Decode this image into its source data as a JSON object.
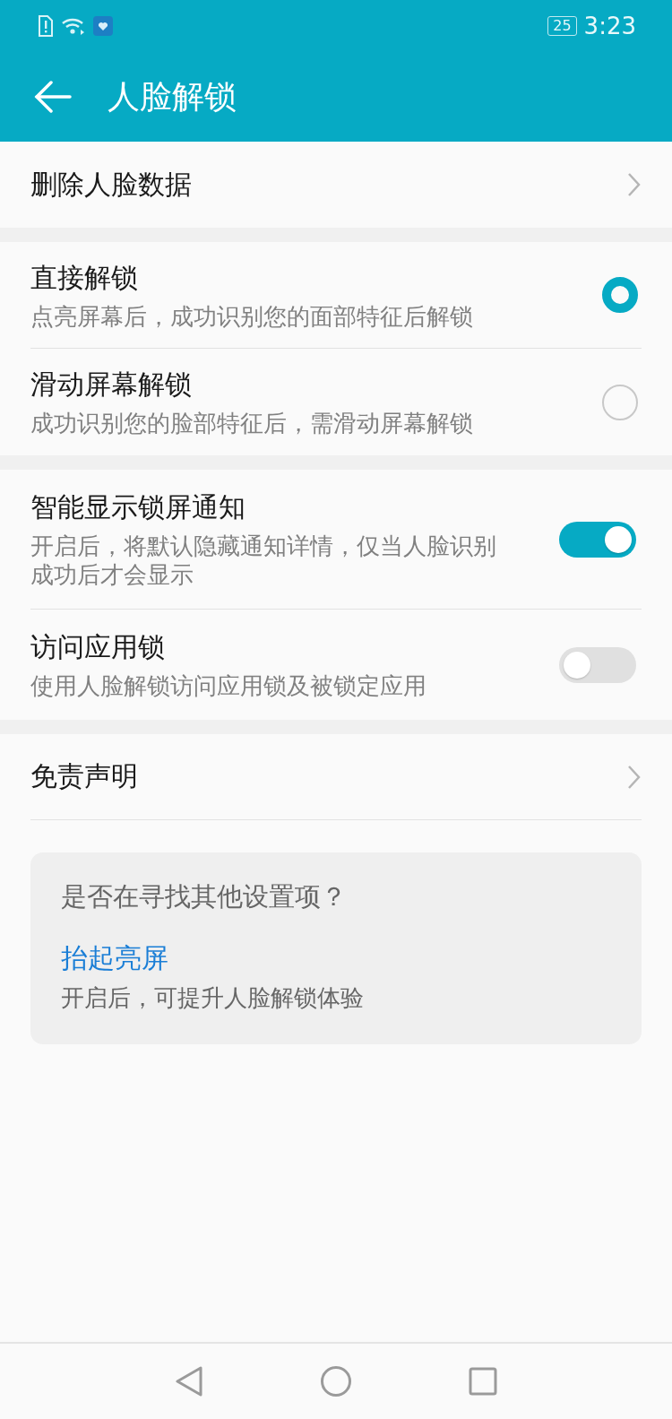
{
  "status_bar": {
    "battery": "25",
    "time": "3:23"
  },
  "header": {
    "title": "人脸解锁"
  },
  "sections": [
    {
      "rows": [
        {
          "kind": "nav",
          "title": "删除人脸数据"
        }
      ]
    },
    {
      "rows": [
        {
          "kind": "radio",
          "title": "直接解锁",
          "subtitle": "点亮屏幕后，成功识别您的面部特征后解锁",
          "selected": true
        },
        {
          "kind": "radio",
          "title": "滑动屏幕解锁",
          "subtitle": "成功识别您的脸部特征后，需滑动屏幕解锁",
          "selected": false
        }
      ]
    },
    {
      "rows": [
        {
          "kind": "switch",
          "title": "智能显示锁屏通知",
          "subtitle": "开启后，将默认隐藏通知详情，仅当人脸识别成功后才会显示",
          "on": true
        },
        {
          "kind": "switch",
          "title": "访问应用锁",
          "subtitle": "使用人脸解锁访问应用锁及被锁定应用",
          "on": false
        }
      ]
    },
    {
      "rows": [
        {
          "kind": "nav",
          "title": "免责声明"
        }
      ]
    }
  ],
  "suggestion": {
    "question": "是否在寻找其他设置项？",
    "links": [
      {
        "label": "抬起亮屏",
        "description": "开启后，可提升人脸解锁体验"
      }
    ]
  }
}
